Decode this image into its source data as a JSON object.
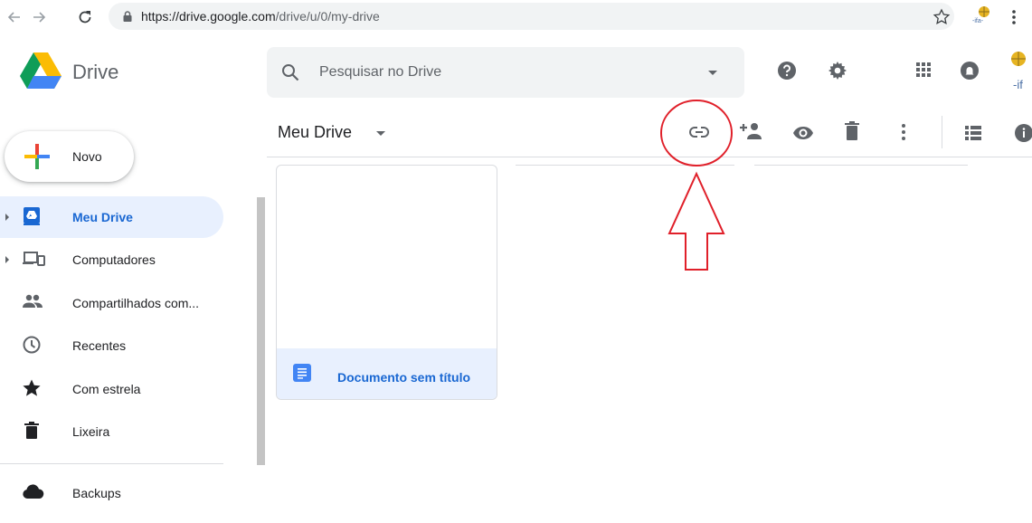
{
  "browser": {
    "url_host": "https://drive.google.com",
    "url_path": "/drive/u/0/my-drive",
    "ext_label": "-ifa-"
  },
  "app": {
    "name": "Drive",
    "search_placeholder": "Pesquisar no Drive",
    "account_label": "-if"
  },
  "new_button": {
    "label": "Novo"
  },
  "sidebar": {
    "items": [
      {
        "label": "Meu Drive",
        "icon": "my-drive-icon",
        "active": true
      },
      {
        "label": "Computadores",
        "icon": "computers-icon"
      },
      {
        "label": "Compartilhados com...",
        "icon": "shared-icon"
      },
      {
        "label": "Recentes",
        "icon": "clock-icon"
      },
      {
        "label": "Com estrela",
        "icon": "star-icon"
      },
      {
        "label": "Lixeira",
        "icon": "trash-icon"
      },
      {
        "label": "Backups",
        "icon": "cloud-icon"
      }
    ]
  },
  "main": {
    "title": "Meu Drive",
    "files": [
      {
        "name": "Documento sem título",
        "type": "doc"
      }
    ]
  },
  "colors": {
    "accent": "#1967d2",
    "active_bg": "#e8f0fe",
    "annotation": "#e0202a",
    "icon": "#5f6368"
  }
}
